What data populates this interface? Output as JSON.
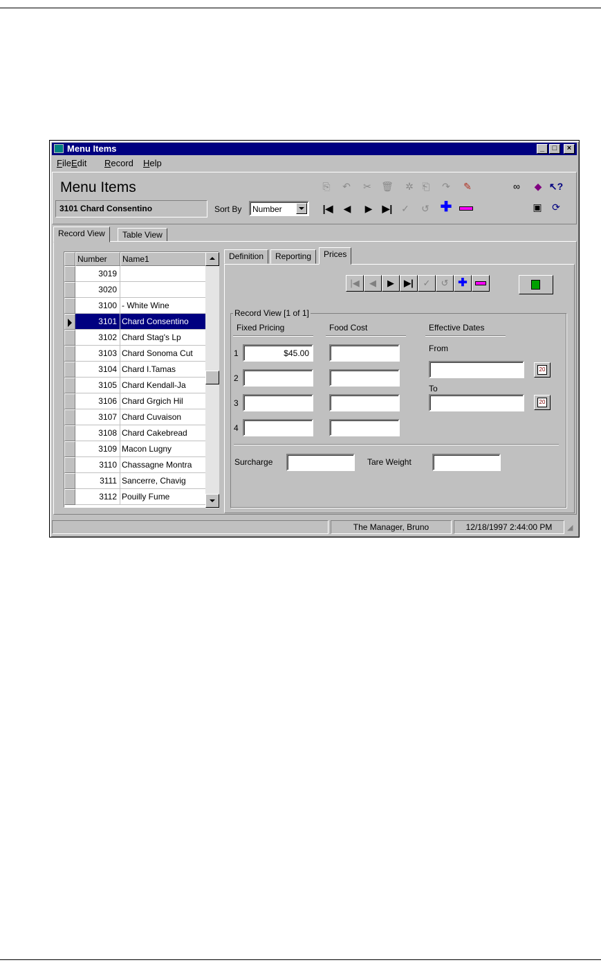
{
  "window": {
    "title": "Menu Items",
    "controls": {
      "minimize": "_",
      "maximize": "□",
      "close": "×"
    }
  },
  "menu": [
    "File",
    "Edit",
    "Record",
    "Help"
  ],
  "header": {
    "title": "Menu Items",
    "current_record": "3101  Chard Consentino",
    "sort_label": "Sort By",
    "sort_value": "Number"
  },
  "main_tabs": [
    "Record View",
    "Table View"
  ],
  "grid": {
    "columns": [
      "Number",
      "Name1"
    ],
    "rows": [
      {
        "number": "3019",
        "name": ""
      },
      {
        "number": "3020",
        "name": ""
      },
      {
        "number": "3100",
        "name": "- White Wine"
      },
      {
        "number": "3101",
        "name": "Chard Consentino"
      },
      {
        "number": "3102",
        "name": "Chard Stag's Lp"
      },
      {
        "number": "3103",
        "name": "Chard Sonoma Cut"
      },
      {
        "number": "3104",
        "name": "Chard I.Tamas"
      },
      {
        "number": "3105",
        "name": "Chard Kendall-Ja"
      },
      {
        "number": "3106",
        "name": "Chard Grgich Hil"
      },
      {
        "number": "3107",
        "name": "Chard Cuvaison"
      },
      {
        "number": "3108",
        "name": "Chard Cakebread"
      },
      {
        "number": "3109",
        "name": "Macon Lugny"
      },
      {
        "number": "3110",
        "name": "Chassagne Montra"
      },
      {
        "number": "3111",
        "name": "Sancerre, Chavig"
      },
      {
        "number": "3112",
        "name": "Pouilly Fume"
      }
    ],
    "selected_number": "3101"
  },
  "detail_tabs": [
    "Definition",
    "Reporting",
    "Prices"
  ],
  "prices": {
    "group_label": "Record View  [1 of 1]",
    "fixed_pricing_header": "Fixed Pricing",
    "food_cost_header": "Food Cost",
    "effective_dates_header": "Effective Dates",
    "rows": [
      {
        "index": "1",
        "price": "$45.00",
        "food_cost": ""
      },
      {
        "index": "2",
        "price": "",
        "food_cost": ""
      },
      {
        "index": "3",
        "price": "",
        "food_cost": ""
      },
      {
        "index": "4",
        "price": "",
        "food_cost": ""
      }
    ],
    "from_label": "From",
    "from_value": "",
    "to_label": "To",
    "to_value": "",
    "calendar_day": "20",
    "surcharge_label": "Surcharge",
    "surcharge_value": "",
    "tare_label": "Tare Weight",
    "tare_value": ""
  },
  "status": {
    "user": "The Manager, Bruno",
    "datetime": "12/18/1997 2:44:00 PM"
  },
  "colors": {
    "titlebar": "#000080",
    "selection": "#000080",
    "window_face": "#c0c0c0",
    "add_icon": "#0000ff",
    "delete_icon": "#ff00ff"
  }
}
